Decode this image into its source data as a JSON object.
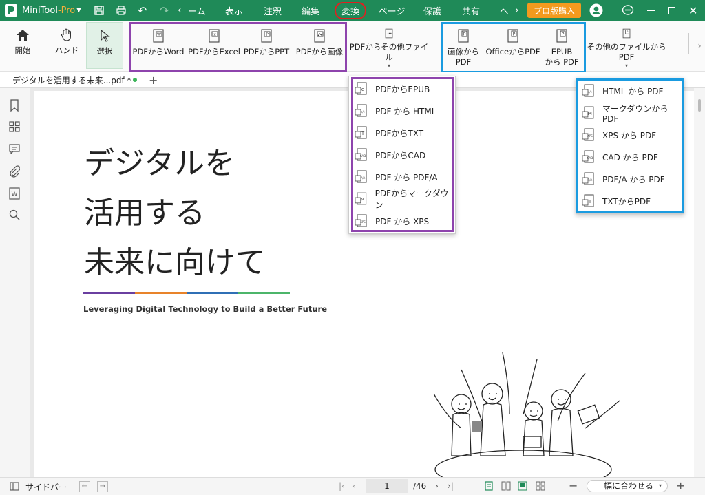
{
  "app": {
    "name": "MiniTool",
    "edition": "-Pro"
  },
  "menu": {
    "left_arrow": "‹",
    "items": [
      "ーム",
      "表示",
      "注釈",
      "編集",
      "変換",
      "ページ",
      "保護",
      "共有",
      "ヘ"
    ],
    "right_arrow": "›",
    "buy_label": "プロ版購入",
    "active": "変換"
  },
  "toolbar": {
    "home": "開始",
    "hand": "ハンド",
    "select": "選択",
    "pdf_to_word": "PDFからWord",
    "pdf_to_excel": "PDFからExcel",
    "pdf_to_ppt": "PDFからPPT",
    "pdf_to_image": "PDFから画像",
    "pdf_to_other": "PDFからその他ファイル",
    "image_to_pdf_1": "画像から",
    "image_to_pdf_2": "PDF",
    "office_to_pdf": "OfficeからPDF",
    "epub_to_pdf_1": "EPUB",
    "epub_to_pdf_2": "から PDF",
    "other_to_pdf": "その他のファイルからPDF"
  },
  "tab": {
    "title": "デジタルを活用する未来...pdf *"
  },
  "dropdown_pdf_to": [
    {
      "label": "PDFからEPUB",
      "icon": "epub-file-icon"
    },
    {
      "label": "PDF から HTML",
      "icon": "html-file-icon"
    },
    {
      "label": "PDFからTXT",
      "icon": "txt-file-icon"
    },
    {
      "label": "PDFからCAD",
      "icon": "cad-file-icon"
    },
    {
      "label": "PDF から PDF/A",
      "icon": "pdfa-file-icon"
    },
    {
      "label": "PDFからマークダウン",
      "icon": "markdown-file-icon"
    },
    {
      "label": "PDF から XPS",
      "icon": "xps-file-icon"
    }
  ],
  "dropdown_to_pdf": [
    {
      "label": "HTML から PDF",
      "icon": "html-file-icon"
    },
    {
      "label": "マークダウンからPDF",
      "icon": "markdown-file-icon"
    },
    {
      "label": "XPS から PDF",
      "icon": "xps-file-icon"
    },
    {
      "label": "CAD から PDF",
      "icon": "cad-file-icon"
    },
    {
      "label": "PDF/A から PDF",
      "icon": "pdfa-file-icon"
    },
    {
      "label": "TXTからPDF",
      "icon": "txt-file-icon"
    }
  ],
  "document": {
    "title_line1": "デジタルを",
    "title_line2": "活用する",
    "title_line3": "未来に向けて",
    "subtitle": "Leveraging Digital Technology to Build a Better Future",
    "rule_colors": [
      "#6a3fa0",
      "#e8832a",
      "#2f6fb5",
      "#4cb56a"
    ]
  },
  "status": {
    "sidebar": "サイドバー",
    "page": "1",
    "total": "/46",
    "zoom": "幅に合わせる"
  },
  "colors": {
    "brand": "#1f8a58",
    "buy": "#f39a1e",
    "purple_box": "#8e44ad",
    "blue_box": "#1a9be0",
    "red_circle": "#e02020"
  }
}
